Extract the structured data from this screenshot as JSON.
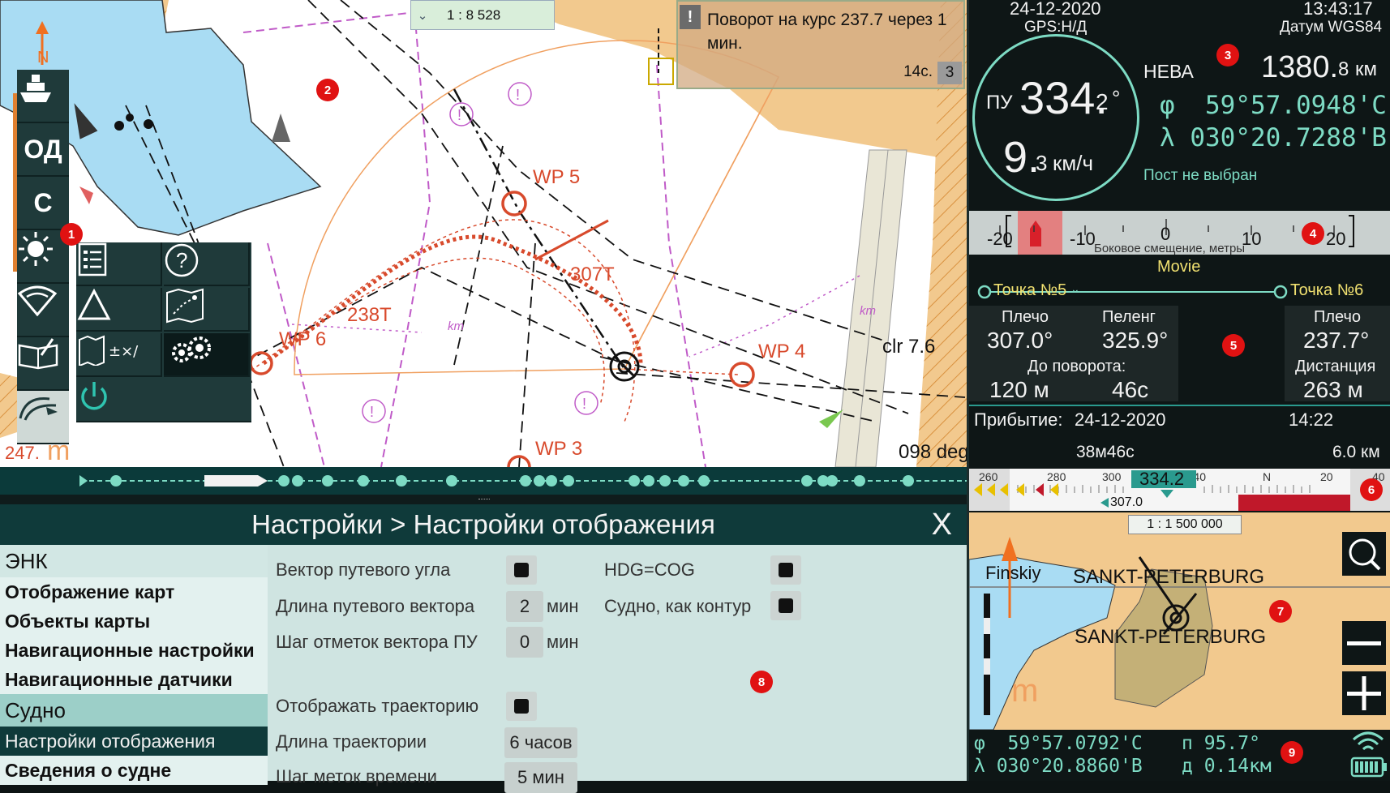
{
  "chart": {
    "scale": "1 : 8 528",
    "alert": {
      "text": "Поворот на курс 237.7 через 1 мин.",
      "time": "14с.",
      "count": "3"
    },
    "waypoints": [
      "WP 5",
      "WP 6",
      "WP 4",
      "WP 3"
    ],
    "leg_labels": [
      "238T",
      "307T"
    ],
    "km_labels": [
      "km",
      "km",
      "km"
    ],
    "clearance": "clr  7.6",
    "depth_label": "098 deg",
    "corner_label": "247.",
    "m_label": "m",
    "north_label": "N"
  },
  "toolbar": {
    "items": [
      {
        "name": "vessel-tool",
        "icon": "ship-icon"
      },
      {
        "name": "od-tool",
        "label": "ОД"
      },
      {
        "name": "c-tool",
        "label": "С"
      },
      {
        "name": "brightness-tool",
        "icon": "sun-icon"
      },
      {
        "name": "view-tool",
        "icon": "eye-icon"
      },
      {
        "name": "logbook-tool",
        "icon": "book-icon"
      },
      {
        "name": "route-tool",
        "icon": "route-icon"
      }
    ]
  },
  "popup_menu": [
    "list-icon",
    "help-icon",
    "triangle-icon",
    "route-map-icon",
    "map-settings-icon",
    "gears-icon",
    "power-icon"
  ],
  "markers": [
    "1",
    "2",
    "3",
    "4",
    "5",
    "6",
    "7",
    "8",
    "9"
  ],
  "nav": {
    "date": "24-12-2020",
    "time": "13:43:17",
    "gps": "GPS:Н/Д",
    "datum": "Датум WGS84",
    "course_prefix": "ПУ",
    "course_int": "334.",
    "course_dec": "2",
    "course_unit": "°",
    "speed_int": "9.",
    "speed_dec": "3",
    "speed_unit": "км/ч",
    "target_name": "НЕВА",
    "distance_int": "1380.",
    "distance_dec": "8",
    "distance_unit": "км",
    "lat": "φ  59°57.0948'С",
    "lon": "λ 030°20.7288'В",
    "post": "Пост не выбран"
  },
  "xtrack": {
    "labels": [
      "-20",
      "-10",
      "0",
      "10",
      "20"
    ],
    "caption": "Боковое смещение, метры"
  },
  "route": {
    "title": "Movie",
    "from_point": "Точка №5",
    "to_point": "Точка №6",
    "left": {
      "shoulder_label": "Плечо",
      "shoulder": "307.0°",
      "bearing_label": "Пеленг",
      "bearing": "325.9°",
      "to_turn_label": "До поворота:",
      "to_turn_dist": "120 м",
      "to_turn_time": "46с"
    },
    "right": {
      "shoulder_label": "Плечо",
      "shoulder": "237.7°",
      "distance_label": "Дистанция",
      "distance": "263 м"
    },
    "arrival_label": "Прибытие:",
    "arrival_date": "24-12-2020",
    "arrival_time": "14:22",
    "eta_remaining": "38м46с",
    "remaining_dist": "6.0 км"
  },
  "compass_strip": {
    "labels": [
      "260",
      "280",
      "300",
      "334.2",
      "340",
      "N",
      "20",
      "40"
    ],
    "current": "334.2",
    "set_course": "307.0"
  },
  "minimap": {
    "scale": "1 : 1 500 000",
    "labels": [
      "Finskiy",
      "SANKT-PETERBURG",
      "SANKT-PETERBURG"
    ],
    "m_label": "m"
  },
  "status": {
    "lat": "φ  59°57.0792'С",
    "lon": "λ 030°20.8860'В",
    "bearing": "п 95.7°",
    "distance": "д 0.14км"
  },
  "settings": {
    "title": "Настройки > Настройки отображения",
    "close": "X",
    "sidebar": [
      {
        "type": "group",
        "label": "ЭНК"
      },
      {
        "type": "item",
        "label": "Отображение карт"
      },
      {
        "type": "item",
        "label": "Объекты карты"
      },
      {
        "type": "item",
        "label": "Навигационные настройки"
      },
      {
        "type": "item",
        "label": "Навигационные датчики"
      },
      {
        "type": "group2",
        "label": "Судно"
      },
      {
        "type": "sel",
        "label": "Настройки отображения"
      },
      {
        "type": "item",
        "label": "Сведения о судне"
      }
    ],
    "options": {
      "cog_vector": "Вектор путевого угла",
      "hdg_cog": "HDG=COG",
      "vector_length": "Длина путевого вектора",
      "vector_length_value": "2",
      "vector_length_unit": "мин",
      "hull_contour": "Судно, как контур",
      "vector_step": "Шаг отметок вектора ПУ",
      "vector_step_value": "0",
      "vector_step_unit": "мин",
      "show_track": "Отображать траекторию",
      "track_length": "Длина траектории",
      "track_length_value": "6 часов",
      "time_step": "Шаг меток времени",
      "time_step_value": "5 мин"
    }
  },
  "colors": {
    "land": "#f2c98e",
    "water": "#a9dcf3",
    "panel": "#0e1616",
    "accent": "#7ddbc4",
    "alert_marker": "#e01212"
  }
}
